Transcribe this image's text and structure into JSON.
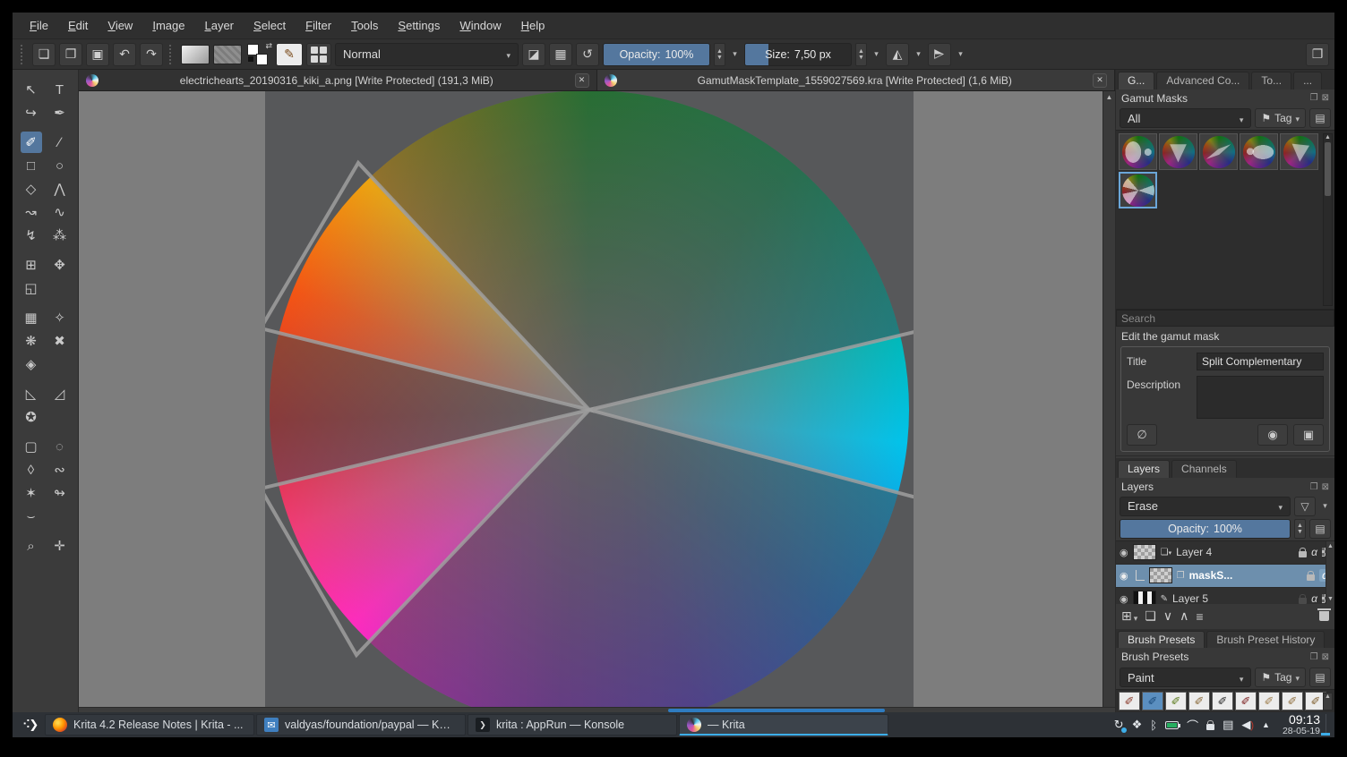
{
  "menu": {
    "items": [
      "File",
      "Edit",
      "View",
      "Image",
      "Layer",
      "Select",
      "Filter",
      "Tools",
      "Settings",
      "Window",
      "Help"
    ]
  },
  "toolbar": {
    "buttons": [
      {
        "name": "new-document",
        "glyph": "❏"
      },
      {
        "name": "open-document",
        "glyph": "❐"
      },
      {
        "name": "save-document",
        "glyph": "▣"
      },
      {
        "name": "undo",
        "glyph": "↶"
      },
      {
        "name": "redo",
        "glyph": "↷"
      },
      {
        "name": "eraser-mode",
        "glyph": "◪"
      },
      {
        "name": "preserve-alpha",
        "glyph": "▦"
      },
      {
        "name": "reload-preset",
        "glyph": "↺"
      },
      {
        "name": "mirror-horizontal",
        "glyph": "◭"
      },
      {
        "name": "mirror-vertical",
        "glyph": "◭"
      },
      {
        "name": "choose-workspace",
        "glyph": "❐"
      }
    ],
    "blend_mode": "Normal",
    "opacity_label": "Opacity:",
    "opacity_value": "100%",
    "size_label": "Size:",
    "size_value": "7,50 px"
  },
  "doc_tabs": [
    {
      "title": "electrichearts_20190316_kiki_a.png [Write Protected]  (191,3 MiB)"
    },
    {
      "title": "GamutMaskTemplate_1559027569.kra [Write Protected]  (1,6 MiB)"
    }
  ],
  "tools": [
    {
      "name": "shape-select-tool",
      "glyph": "↖"
    },
    {
      "name": "text-tool",
      "glyph": "T"
    },
    {
      "name": "edit-shapes-tool",
      "glyph": "↪"
    },
    {
      "name": "calligraphy-tool",
      "glyph": "✒"
    },
    {
      "name": "freehand-brush-tool",
      "glyph": "✐"
    },
    {
      "name": "line-tool",
      "glyph": "∕"
    },
    {
      "name": "rectangle-tool",
      "glyph": "□"
    },
    {
      "name": "ellipse-tool",
      "glyph": "○"
    },
    {
      "name": "polygon-tool",
      "glyph": "◇"
    },
    {
      "name": "polyline-tool",
      "glyph": "⋀"
    },
    {
      "name": "bezier-curve-tool",
      "glyph": "↝"
    },
    {
      "name": "freehand-path-tool",
      "glyph": "∿"
    },
    {
      "name": "dynamic-brush-tool",
      "glyph": "↯"
    },
    {
      "name": "multibrush-tool",
      "glyph": "⁂"
    },
    {
      "name": "transform-tool",
      "glyph": "⊞"
    },
    {
      "name": "move-tool",
      "glyph": "✥"
    },
    {
      "name": "crop-tool",
      "glyph": "◱"
    },
    {
      "name": "gradient-tool",
      "glyph": "▦"
    },
    {
      "name": "color-sampler-tool",
      "glyph": "✧"
    },
    {
      "name": "smart-patch-tool",
      "glyph": "❋"
    },
    {
      "name": "pattern-edit-tool",
      "glyph": "✖"
    },
    {
      "name": "fill-tool",
      "glyph": "◈"
    },
    {
      "name": "assistants-tool",
      "glyph": "◺"
    },
    {
      "name": "measure-tool",
      "glyph": "◿"
    },
    {
      "name": "reference-images-tool",
      "glyph": "✪"
    },
    {
      "name": "rect-select-tool",
      "glyph": "▢"
    },
    {
      "name": "ellipse-select-tool",
      "glyph": "◌"
    },
    {
      "name": "poly-select-tool",
      "glyph": "◊"
    },
    {
      "name": "freehand-select-tool",
      "glyph": "∾"
    },
    {
      "name": "similar-select-tool",
      "glyph": "✶"
    },
    {
      "name": "bezier-select-tool",
      "glyph": "↬"
    },
    {
      "name": "magnetic-select-tool",
      "glyph": "⌣"
    },
    {
      "name": "zoom-tool",
      "glyph": "⌕"
    },
    {
      "name": "pan-tool",
      "glyph": "✛"
    }
  ],
  "gamut_masks": {
    "tabs": [
      "G...",
      "Advanced Co...",
      "To...",
      "..."
    ],
    "header": "Gamut Masks",
    "filter": "All",
    "tag": "Tag",
    "search_placeholder": "Search",
    "edit_label": "Edit the gamut mask",
    "title_label": "Title",
    "title_value": "Split Complementary",
    "description_label": "Description",
    "buttons": {
      "cancel": "∅",
      "preview": "◉",
      "save": "▣"
    }
  },
  "layers": {
    "tab_layers": "Layers",
    "tab_channels": "Channels",
    "header": "Layers",
    "blend_mode": "Erase",
    "opacity_label": "Opacity:",
    "opacity_value": "100%",
    "rows": [
      {
        "name": "Layer 4"
      },
      {
        "name": "maskS..."
      },
      {
        "name": "Layer 5"
      }
    ],
    "alpha_glyph": "α",
    "buttons": {
      "add": "⊞",
      "duplicate": "❏",
      "move_down": "∨",
      "move_up": "∧",
      "properties": "≡"
    }
  },
  "brush_presets": {
    "tab_presets": "Brush Presets",
    "tab_history": "Brush Preset History",
    "header": "Brush Presets",
    "filter": "Paint",
    "tag": "Tag",
    "cells": [
      {
        "glyph": "✐",
        "color": "#8a3a2a"
      },
      {
        "glyph": "✐",
        "color": "#1a4a7a"
      },
      {
        "glyph": "✐",
        "color": "#5a7a1a"
      },
      {
        "glyph": "✐",
        "color": "#8a6a3a"
      },
      {
        "glyph": "✐",
        "color": "#2a2a2a"
      },
      {
        "glyph": "✐",
        "color": "#7a1a1a"
      },
      {
        "glyph": "✐",
        "color": "#a08050"
      },
      {
        "glyph": "✐",
        "color": "#907040"
      },
      {
        "glyph": "✐",
        "color": "#806030"
      }
    ]
  },
  "taskbar": {
    "tasks": [
      {
        "label": "Krita 4.2 Release Notes | Krita - ..."
      },
      {
        "label": "valdyas/foundation/paypal — KM..."
      },
      {
        "label": "krita : AppRun — Konsole"
      },
      {
        "label": "— Krita"
      }
    ],
    "tray": [
      {
        "name": "software-update-icon",
        "glyph": "↻"
      },
      {
        "name": "activities-icon",
        "glyph": "❖"
      },
      {
        "name": "bluetooth-icon",
        "glyph": "ᛒ"
      },
      {
        "name": "wifi-icon",
        "glyph": "⌒"
      },
      {
        "name": "clipboard-icon",
        "glyph": "▤"
      },
      {
        "name": "volume-icon",
        "glyph": "◀"
      },
      {
        "name": "expand-tray-icon",
        "glyph": "▲"
      }
    ],
    "clock_time": "09:13",
    "clock_date": "28-05-19"
  },
  "icons": {
    "kmail": "✉",
    "konsole": "❯",
    "launcher_dots": "⠪",
    "launcher_arrow": "❯",
    "envelope": "✉"
  },
  "colors": {
    "accent": "#3daee9",
    "slider_fill": "#54779e",
    "selection": "#6d8fad",
    "canvas_bg": "#7d7d7d",
    "document_bg": "#57585a",
    "scroll_handle": "#2f7cc0"
  }
}
